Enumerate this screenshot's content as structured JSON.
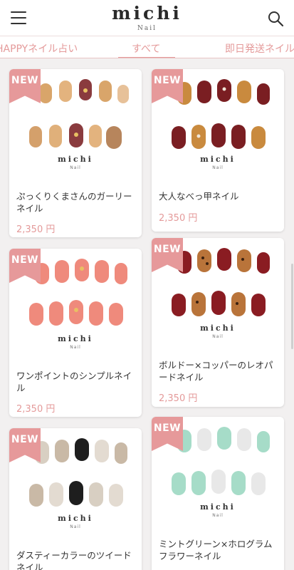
{
  "header": {
    "menu_icon": "hamburger-menu-icon",
    "logo": "michi",
    "logo_sub": "Nail",
    "search_icon": "search-icon"
  },
  "tabs": [
    {
      "label": "HAPPYネイル占い",
      "active": false
    },
    {
      "label": "すべて",
      "active": true
    },
    {
      "label": "即日発送ネイル",
      "active": false
    }
  ],
  "products": [
    {
      "badge": "NEW",
      "brand": "michi",
      "brand_sub": "Nail",
      "title": "ぷっくりくまさんのガーリーネイル",
      "price": "2,350 円"
    },
    {
      "badge": "NEW",
      "brand": "michi",
      "brand_sub": "Nail",
      "title": "大人なべっ甲ネイル",
      "price": "2,350 円"
    },
    {
      "badge": "NEW",
      "brand": "michi",
      "brand_sub": "Nail",
      "title": "ワンポイントのシンプルネイル",
      "price": "2,350 円"
    },
    {
      "badge": "NEW",
      "brand": "michi",
      "brand_sub": "Nail",
      "title": "ボルドー×コッパーのレオパードネイル",
      "price": "2,350 円"
    },
    {
      "badge": "NEW",
      "brand": "michi",
      "brand_sub": "Nail",
      "title": "ダスティーカラーのツイードネイル",
      "price": ""
    },
    {
      "badge": "NEW",
      "brand": "michi",
      "brand_sub": "Nail",
      "title": "ミントグリーン×ホログラムフラワーネイル",
      "price": ""
    }
  ],
  "colors": {
    "accent": "#e49a9a",
    "ribbon": "#e6999a",
    "background": "#f2f0f0"
  }
}
